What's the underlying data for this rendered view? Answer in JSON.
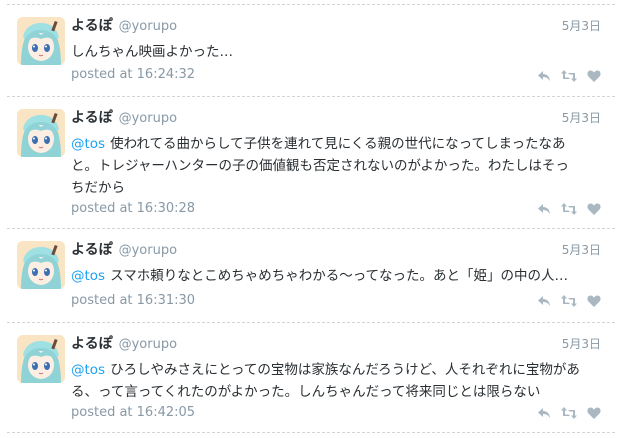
{
  "tweets": [
    {
      "name": "よるぽ",
      "handle": "@yorupo",
      "date": "5月3日",
      "mention": "",
      "lines": [
        "しんちゃん映画よかった…"
      ],
      "posted": "posted at 16:24:32",
      "avatar_icon": "anime-avatar-icon"
    },
    {
      "name": "よるぽ",
      "handle": "@yorupo",
      "date": "5月3日",
      "mention": "@tos",
      "lines": [
        "使われてる曲からして子供を連れて見にくる親の世代になってしまったなあ",
        "と。トレジャーハンターの子の価値観も否定されないのがよかった。わたしはそっ",
        "ちだから"
      ],
      "posted": "posted at 16:30:28",
      "avatar_icon": "anime-avatar-icon"
    },
    {
      "name": "よるぽ",
      "handle": "@yorupo",
      "date": "5月3日",
      "mention": "@tos",
      "lines": [
        "スマホ頼りなとこめちゃめちゃわかる〜ってなった。あと「姫」の中の人…"
      ],
      "posted": "posted at 16:31:30",
      "avatar_icon": "anime-avatar-icon"
    },
    {
      "name": "よるぽ",
      "handle": "@yorupo",
      "date": "5月3日",
      "mention": "@tos",
      "lines": [
        "ひろしやみさえにとっての宝物は家族なんだろうけど、人それぞれに宝物があ",
        "る、って言ってくれたのがよかった。しんちゃんだって将来同じとは限らない"
      ],
      "posted": "posted at 16:42:05",
      "avatar_icon": "anime-avatar-icon"
    }
  ],
  "colors": {
    "mention": "#1da1f2",
    "meta": "#8899a6",
    "text": "#292f33",
    "icon": "#aab8c2"
  }
}
